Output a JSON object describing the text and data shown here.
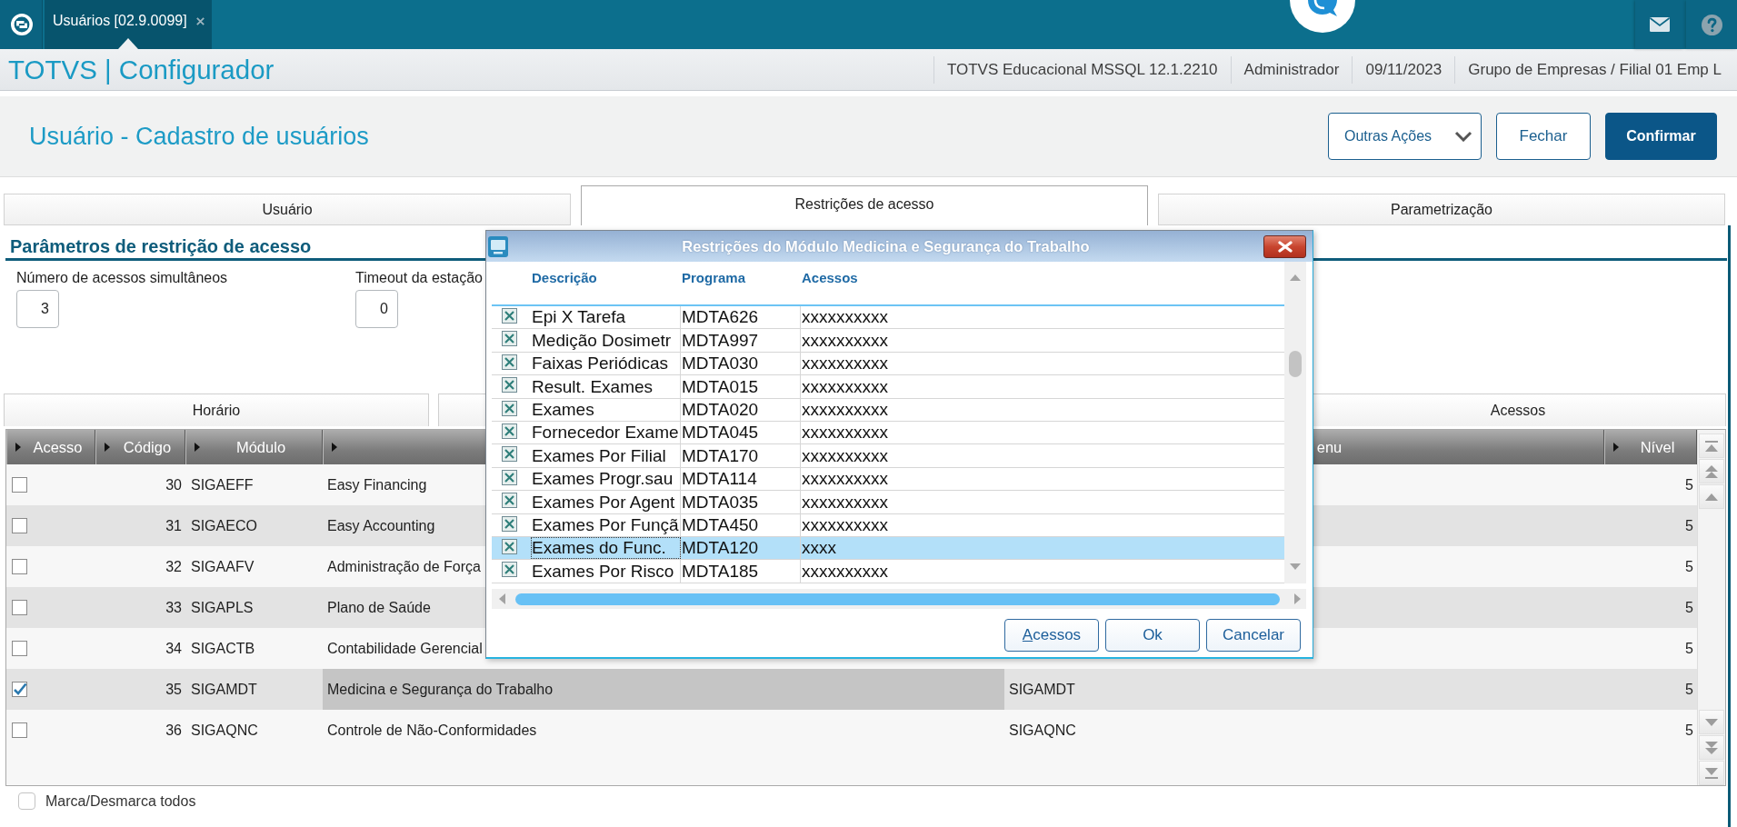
{
  "app_tab": {
    "label": "Usuários [02.9.0099]",
    "selected": true
  },
  "header": {
    "title": "TOTVS | Configurador",
    "info": [
      "TOTVS Educacional MSSQL 12.1.2210",
      "Administrador",
      "09/11/2023",
      "Grupo de Empresas / Filial 01 Emp L"
    ]
  },
  "page": {
    "title": "Usuário - Cadastro de usuários",
    "actions": [
      {
        "label": "Outras Ações",
        "kind": "dropdown"
      },
      {
        "label": "Fechar",
        "kind": "secondary"
      },
      {
        "label": "Confirmar",
        "kind": "primary"
      }
    ]
  },
  "tabs": [
    {
      "label": "Usuário",
      "selected": false
    },
    {
      "label": "Restrições de acesso",
      "selected": true
    },
    {
      "label": "Parametrização",
      "selected": false
    }
  ],
  "section": {
    "title": "Parâmetros de restrição de acesso",
    "fields": [
      {
        "label": "Número de acessos simultâneos",
        "value": "3"
      },
      {
        "label": "Timeout da estação",
        "value": "0"
      }
    ]
  },
  "inner_tabs": [
    {
      "label": "Horário"
    },
    {
      "label": "Acessos"
    }
  ],
  "grid": {
    "columns": {
      "acesso": "Acesso",
      "codigo": "Código",
      "modulo": "Módulo",
      "column_5": "enu",
      "nivel": "Nível"
    },
    "rows": [
      {
        "checked": false,
        "selected": false,
        "codigo": "30",
        "modulo": "SIGAEFF",
        "column_4": "Easy Financing",
        "nivel": "5"
      },
      {
        "checked": false,
        "selected": false,
        "codigo": "31",
        "modulo": "SIGAECO",
        "column_4": "Easy Accounting",
        "nivel": "5"
      },
      {
        "checked": false,
        "selected": false,
        "codigo": "32",
        "modulo": "SIGAAFV",
        "column_4": "Administração de Força",
        "nivel": "5"
      },
      {
        "checked": false,
        "selected": false,
        "codigo": "33",
        "modulo": "SIGAPLS",
        "column_4": "Plano de Saúde",
        "nivel": "5"
      },
      {
        "checked": false,
        "selected": false,
        "codigo": "34",
        "modulo": "SIGACTB",
        "column_4": "Contabilidade Gerencial",
        "nivel": "5"
      },
      {
        "checked": true,
        "selected": true,
        "codigo": "35",
        "modulo": "SIGAMDT",
        "column_4": "Medicina e Segurança do Trabalho",
        "column_5": "SIGAMDT",
        "nivel": "5"
      },
      {
        "checked": false,
        "selected": false,
        "codigo": "36",
        "modulo": "SIGAQNC",
        "column_4": "Controle de Não-Conformidades",
        "column_5": "SIGAQNC",
        "nivel": "5"
      }
    ]
  },
  "select_all": {
    "label": "Marca/Desmarca todos",
    "checked": false
  },
  "dialog": {
    "title": "Restrições do Módulo Medicina e Segurança do Trabalho",
    "columns": [
      "Descrição",
      "Programa",
      "Acessos"
    ],
    "rows": [
      {
        "checked": true,
        "selected": false,
        "descricao": "Epi X Tarefa",
        "programa": "MDTA626",
        "acessos": "xxxxxxxxxx"
      },
      {
        "checked": true,
        "selected": false,
        "descricao": "Medição Dosimetr",
        "programa": "MDTA997",
        "acessos": "xxxxxxxxxx"
      },
      {
        "checked": true,
        "selected": false,
        "descricao": "Faixas Periódicas",
        "programa": "MDTA030",
        "acessos": "xxxxxxxxxx"
      },
      {
        "checked": true,
        "selected": false,
        "descricao": "Result. Exames",
        "programa": "MDTA015",
        "acessos": "xxxxxxxxxx"
      },
      {
        "checked": true,
        "selected": false,
        "descricao": "Exames",
        "programa": "MDTA020",
        "acessos": "xxxxxxxxxx"
      },
      {
        "checked": true,
        "selected": false,
        "descricao": "Fornecedor Exame",
        "programa": "MDTA045",
        "acessos": "xxxxxxxxxx"
      },
      {
        "checked": true,
        "selected": false,
        "descricao": "Exames Por Filial",
        "programa": "MDTA170",
        "acessos": "xxxxxxxxxx"
      },
      {
        "checked": true,
        "selected": false,
        "descricao": "Exames Progr.sau",
        "programa": "MDTA114",
        "acessos": "xxxxxxxxxx"
      },
      {
        "checked": true,
        "selected": false,
        "descricao": "Exames Por Agent",
        "programa": "MDTA035",
        "acessos": "xxxxxxxxxx"
      },
      {
        "checked": true,
        "selected": false,
        "descricao": "Exames Por Funçã",
        "programa": "MDTA450",
        "acessos": "xxxxxxxxxx"
      },
      {
        "checked": true,
        "selected": true,
        "descricao": "Exames do Func.",
        "programa": "MDTA120",
        "acessos": "xxxx"
      },
      {
        "checked": true,
        "selected": false,
        "descricao": "Exames Por Risco",
        "programa": "MDTA185",
        "acessos": "xxxxxxxxxx"
      }
    ],
    "buttons": [
      {
        "label": "Acessos",
        "mnemonic": true
      },
      {
        "label": "Ok",
        "mnemonic": false
      },
      {
        "label": "Cancelar",
        "mnemonic": false
      }
    ]
  }
}
